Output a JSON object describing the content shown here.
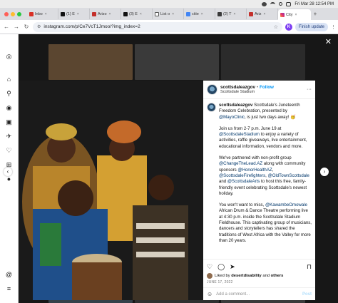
{
  "menubar": {
    "datetime": "Fri Mar 28  12:54 PM"
  },
  "tabs": [
    {
      "label": "Inbo",
      "color": "#d93025"
    },
    {
      "label": "(1) E",
      "color": "#111111"
    },
    {
      "label": "Arizo",
      "color": "#c4302b"
    },
    {
      "label": "(3) E",
      "color": "#111111"
    },
    {
      "label": "List o",
      "color": "#555555"
    },
    {
      "label": "citie",
      "color": "#4285f4"
    },
    {
      "label": "(2) T",
      "color": "#3a3a3a"
    },
    {
      "label": "Ariz",
      "color": "#c4302b"
    },
    {
      "label": "City",
      "color": "#e1306c",
      "active": true
    }
  ],
  "address": {
    "url": "instagram.com/p/Ce7VcT1Jmoo/?img_index=2"
  },
  "browser": {
    "profile_initial": "K",
    "finish_update_label": "Finish update"
  },
  "post": {
    "username": "scottsdaleazgov",
    "follow_label": "Follow",
    "location": "Scottsdale Stadium",
    "caption": {
      "p1_mention_user": "scottsdaleazgov",
      "p1_text": " Scottsdale's Juneteenth Freedom Celebration, presented by ",
      "p1_mention": "@MayoClinic",
      "p1_end": ", is just two days away! 🥳",
      "p2_a": "Join us from 2-7 p.m. June 19 at ",
      "p2_mention": "@ScottsdaleStadium",
      "p2_b": " to enjoy a variety of activities, raffle giveaways, live entertainment, educational information, vendors and more.",
      "p3_a": "We've partnered with non-profit group ",
      "p3_m1": "@ChangeTheLead.AZ",
      "p3_b": " along with community sponsors ",
      "p3_m2": "@HonorHealthAZ",
      "p3_c": ", ",
      "p3_m3": "@ScottsdaleFirefighters",
      "p3_d": ", ",
      "p3_m4": "@OldTownScottsdale",
      "p3_e": " and ",
      "p3_m5": "@ScottsdaleArts",
      "p3_f": " to host this free, family-friendly event celebrating Scottsdale's newest holiday.",
      "p4_a": "You won't want to miss, ",
      "p4_mention": "@KawambeOmowale",
      "p4_b": " African Drum & Dance Theatre performing live at 4:30 p.m. inside the Scottsdale Stadium Fieldhouse.  This captivating group of musicians, dancers and storytellers has shared the traditions of West Africa with the Valley for more than 20 years."
    },
    "likes_prefix": "Liked by ",
    "likes_user": "desertdisability",
    "likes_middle": " and ",
    "likes_others": "others",
    "date": "JUNE 17, 2022",
    "comment_placeholder": "Add a comment...",
    "post_label": "Post"
  },
  "colors": {
    "instagram_blue": "#0095f6",
    "mention": "#00376b"
  }
}
